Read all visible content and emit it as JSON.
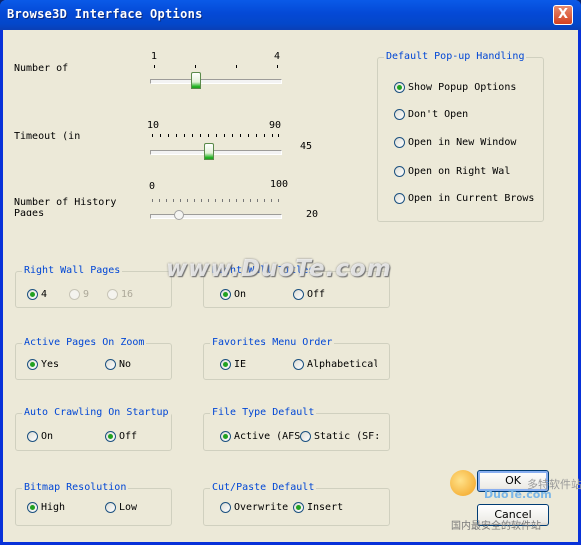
{
  "window": {
    "title": "Browse3D Interface Options",
    "close_glyph": "X"
  },
  "sliders": {
    "number_of": {
      "label": "Number of",
      "min": "1",
      "max": "4",
      "value_text": "",
      "value": 2
    },
    "timeout": {
      "label": "Timeout (in",
      "min": "10",
      "max": "90",
      "value_text": "45",
      "value": 45
    },
    "history": {
      "label_line1": "Number of History",
      "label_line2": "Pages",
      "min": "0",
      "max": "100",
      "value_text": "20",
      "value": 20
    }
  },
  "popup": {
    "legend": "Default Pop-up Handling",
    "options": [
      "Show Popup Options",
      "Don't Open",
      "Open in New Window",
      "Open on Right Wal",
      "Open in Current Brows"
    ],
    "selected": 0
  },
  "groups": {
    "right_wall_pages": {
      "legend": "Right Wall Pages",
      "options": [
        "4",
        "9",
        "16"
      ]
    },
    "right_wall_titles": {
      "legend": "Right Wall Titles",
      "options": [
        "On",
        "Off"
      ]
    },
    "active_pages_zoom": {
      "legend": "Active Pages On Zoom",
      "options": [
        "Yes",
        "No"
      ]
    },
    "favorites_order": {
      "legend": "Favorites Menu Order",
      "options": [
        "IE",
        "Alphabetical"
      ]
    },
    "auto_crawling": {
      "legend": "Auto Crawling On Startup",
      "options": [
        "On",
        "Off"
      ]
    },
    "file_type": {
      "legend": "File Type Default",
      "options": [
        "Active (AFS",
        "Static (SF:"
      ]
    },
    "bitmap_resolution": {
      "legend": "Bitmap Resolution",
      "options": [
        "High",
        "Low"
      ]
    },
    "cut_paste": {
      "legend": "Cut/Paste Default",
      "options": [
        "Overwrite",
        "Insert"
      ]
    }
  },
  "buttons": {
    "ok": "OK",
    "cancel": "Cancel"
  },
  "watermark": {
    "main": "www.DuoTe.com",
    "site": "DuoTe.com",
    "cn1": "多特软件站",
    "cn2": "国内最安全的软件站"
  },
  "colors": {
    "title_bar": "#0449d6",
    "group_legend": "#0046d5",
    "radio_dot": "#21a121",
    "dialog_bg": "#ece9d8"
  }
}
